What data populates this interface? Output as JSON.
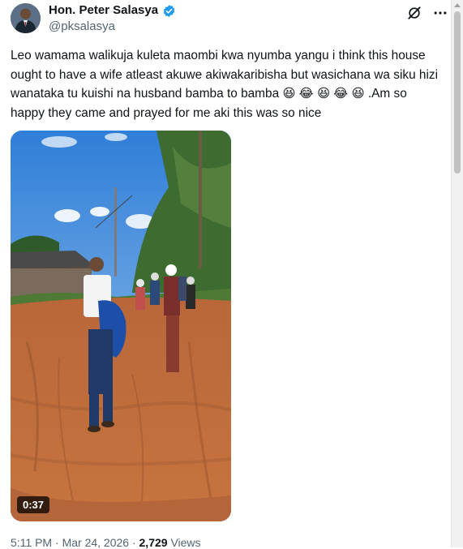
{
  "author": {
    "display_name": "Hon. Peter Salasya",
    "handle": "@pksalasya",
    "verified": true
  },
  "tweet": {
    "text": "Leo wamama walikuja kuleta maombi kwa nyumba yangu i think this house ought to have a wife atleast akuwe akiwakaribisha but wasichana wa siku hizi wanataka tu kuishi na husband bamba to bamba 😆 😂 😆 😂 😆 .Am so happy they came and prayed for me aki this was so nice"
  },
  "media": {
    "type": "video",
    "duration": "0:37"
  },
  "meta": {
    "time": "5:11 PM",
    "separator": "·",
    "date": "Mar 24, 2026",
    "views_count": "2,729",
    "views_label": "Views"
  },
  "icons": {
    "grok": "grok-slash-icon",
    "more": "more-dots-icon",
    "verified": "verified-badge-icon"
  },
  "colors": {
    "text": "#0f1419",
    "secondary": "#536471",
    "verified": "#1d9bf0"
  }
}
